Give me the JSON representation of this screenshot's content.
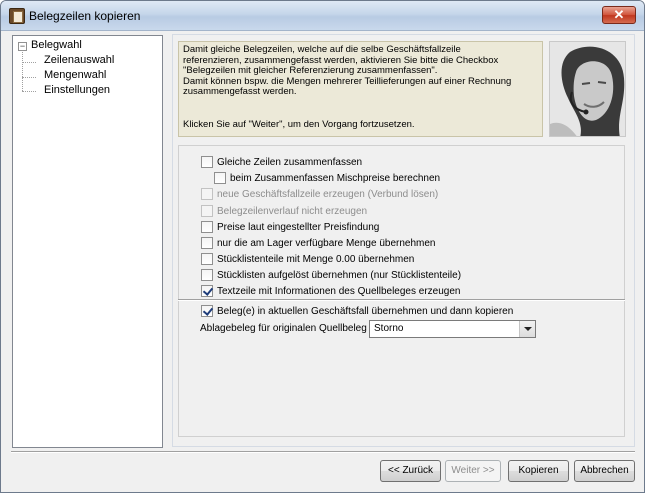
{
  "window": {
    "title": "Belegzeilen kopieren",
    "close_glyph": "✕"
  },
  "nav": {
    "toggle_glyph": "−",
    "root": "Belegwahl",
    "items": [
      "Zeilenauswahl",
      "Mengenwahl",
      "Einstellungen"
    ]
  },
  "info": {
    "lines": [
      "Damit gleiche Belegzeilen, welche auf die selbe Geschäftsfallzeile",
      "referenzieren, zusammengefasst werden, aktivieren Sie bitte die Checkbox",
      "\"Belegzeilen mit gleicher Referenzierung zusammenfassen\".",
      "Damit können bspw. die Mengen mehrerer Teillieferungen auf einer Rechnung",
      "zusammengefasst werden."
    ],
    "hint": "Klicken Sie auf \"Weiter\", um den Vorgang fortzusetzen."
  },
  "options": [
    {
      "label": "Gleiche Zeilen zusammenfassen",
      "checked": false,
      "disabled": false
    },
    {
      "label": "beim Zusammenfassen Mischpreise berechnen",
      "checked": false,
      "disabled": false
    },
    {
      "label": "neue Geschäftsfallzeile erzeugen (Verbund lösen)",
      "checked": false,
      "disabled": true
    },
    {
      "label": "Belegzeilenverlauf nicht erzeugen",
      "checked": false,
      "disabled": true
    },
    {
      "label": "Preise laut eingestellter Preisfindung",
      "checked": false,
      "disabled": false
    },
    {
      "label": "nur die am Lager verfügbare Menge übernehmen",
      "checked": false,
      "disabled": false
    },
    {
      "label": "Stücklistenteile mit Menge 0.00 übernehmen",
      "checked": false,
      "disabled": false
    },
    {
      "label": "Stücklisten aufgelöst übernehmen (nur Stücklistenteile)",
      "checked": false,
      "disabled": false
    },
    {
      "label": "Textzeile mit Informationen des Quellbeleges erzeugen",
      "checked": true,
      "disabled": false
    }
  ],
  "copy_option": {
    "label": "Beleg(e) in aktuellen Geschäftsfall übernehmen und dann kopieren",
    "checked": true
  },
  "storage": {
    "label": "Ablagebeleg für originalen Quellbeleg",
    "selected": "Storno"
  },
  "buttons": {
    "back": "<< Zurück",
    "next": "Weiter >>",
    "copy": "Kopieren",
    "cancel": "Abbrechen"
  }
}
